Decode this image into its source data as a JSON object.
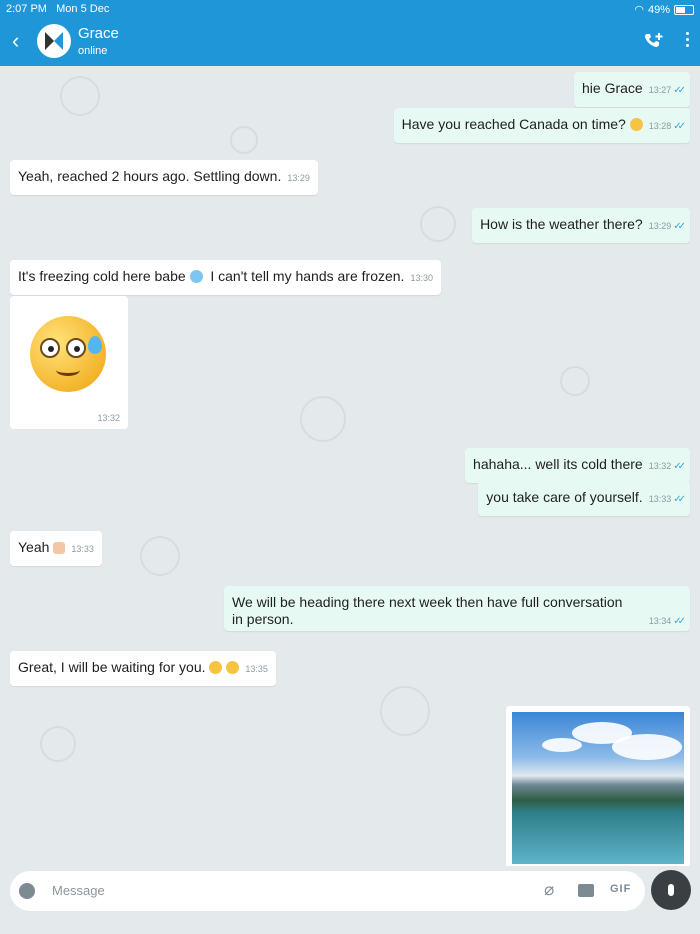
{
  "status_bar": {
    "time": "2:07 PM",
    "date": "Mon 5 Dec",
    "battery": "49%"
  },
  "header": {
    "back_label": "‹",
    "contact_name": "Grace",
    "contact_status": "online"
  },
  "messages": [
    {
      "dir": "out",
      "text": "hie Grace",
      "time": "13:27"
    },
    {
      "dir": "out",
      "text": "Have you reached Canada on time?",
      "time": "13:28"
    },
    {
      "dir": "in",
      "text": "Yeah, reached 2 hours ago. Settling down.",
      "time": "13:29"
    },
    {
      "dir": "out",
      "text": "How is the weather there?",
      "time": "13:29"
    },
    {
      "dir": "in",
      "text": "It's freezing cold here babe",
      "text2": "I can't tell my hands are frozen.",
      "time": "13:30"
    },
    {
      "dir": "in",
      "type": "sticker",
      "time": "13:32"
    },
    {
      "dir": "out",
      "text": "hahaha... well its cold there",
      "time": "13:32"
    },
    {
      "dir": "out",
      "text": "you take care of yourself.",
      "time": "13:33"
    },
    {
      "dir": "in",
      "text": "Yeah",
      "time": "13:33"
    },
    {
      "dir": "out",
      "text": "We will be heading there next week then have full conversation",
      "text2": "in person.",
      "time": "13:34"
    },
    {
      "dir": "in",
      "text": "Great, I will be waiting for you.",
      "time": "13:35"
    },
    {
      "dir": "out",
      "type": "photo"
    }
  ],
  "input": {
    "placeholder": "Message",
    "gif_label": "GIF"
  },
  "icons": [
    "back-icon",
    "avatar",
    "add-call-icon",
    "more-options-icon",
    "emoji-icon",
    "attach-icon",
    "camera-icon",
    "gif-icon",
    "mic-icon"
  ],
  "colors": {
    "header": "#1f96d8",
    "outgoing": "#e7f9f3",
    "incoming": "#ffffff",
    "ticks": "#3aa3e0"
  }
}
